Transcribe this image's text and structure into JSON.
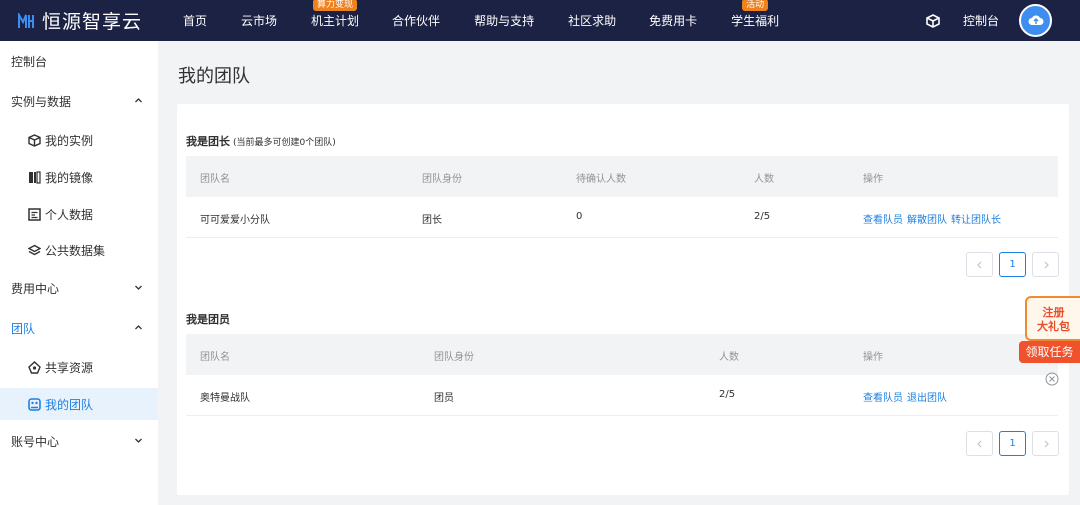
{
  "brand": {
    "name": "恒源智享云"
  },
  "nav": {
    "items": [
      {
        "label": "首页",
        "badge": ""
      },
      {
        "label": "云市场",
        "badge": ""
      },
      {
        "label": "机主计划",
        "badge": "算力变现"
      },
      {
        "label": "合作伙伴",
        "badge": ""
      },
      {
        "label": "帮助与支持",
        "badge": ""
      },
      {
        "label": "社区求助",
        "badge": ""
      },
      {
        "label": "免费用卡",
        "badge": ""
      },
      {
        "label": "学生福利",
        "badge": "活动"
      }
    ],
    "console": "控制台"
  },
  "sidebar": {
    "console": "控制台",
    "instances_data": "实例与数据",
    "my_instances": "我的实例",
    "my_images": "我的镜像",
    "personal_data": "个人数据",
    "public_datasets": "公共数据集",
    "billing": "费用中心",
    "team": "团队",
    "shared_resources": "共享资源",
    "my_teams": "我的团队",
    "account": "账号中心"
  },
  "page": {
    "title": "我的团队"
  },
  "leader": {
    "title": "我是团长",
    "note": "(当前最多可创建0个团队)",
    "headers": [
      "团队名",
      "团队身份",
      "待确认人数",
      "人数",
      "操作"
    ],
    "rows": [
      {
        "name": "可可爱爱小分队",
        "role": "团长",
        "pending": "0",
        "members": "2/5",
        "actions": [
          "查看队员",
          "解散团队",
          "转让团队长"
        ]
      }
    ],
    "page": "1"
  },
  "member": {
    "title": "我是团员",
    "headers": [
      "团队名",
      "团队身份",
      "人数",
      "操作"
    ],
    "rows": [
      {
        "name": "奥特曼战队",
        "role": "团员",
        "members": "2/5",
        "actions": [
          "查看队员",
          "退出团队"
        ]
      }
    ],
    "page": "1"
  },
  "promo": {
    "line1": "注册",
    "line2": "大礼包",
    "cta": "领取任务"
  },
  "colors": {
    "nav_bg": "#1c2244",
    "accent": "#1e80e1",
    "badge": "#f0821e",
    "promo": "#f0522e"
  }
}
